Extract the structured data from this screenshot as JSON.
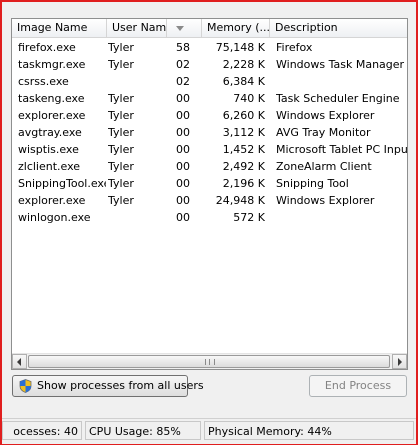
{
  "columns": {
    "image_name": "Image Name",
    "user_name": "User Name",
    "cpu": "",
    "memory": "Memory (...",
    "description": "Description"
  },
  "processes": [
    {
      "name": "firefox.exe",
      "user": "Tyler",
      "cpu": "58",
      "memory": "75,148 K",
      "description": "Firefox"
    },
    {
      "name": "taskmgr.exe",
      "user": "Tyler",
      "cpu": "02",
      "memory": "2,228 K",
      "description": "Windows Task Manager"
    },
    {
      "name": "csrss.exe",
      "user": "",
      "cpu": "02",
      "memory": "6,384 K",
      "description": ""
    },
    {
      "name": "taskeng.exe",
      "user": "Tyler",
      "cpu": "00",
      "memory": "740 K",
      "description": "Task Scheduler Engine"
    },
    {
      "name": "explorer.exe",
      "user": "Tyler",
      "cpu": "00",
      "memory": "6,260 K",
      "description": "Windows Explorer"
    },
    {
      "name": "avgtray.exe",
      "user": "Tyler",
      "cpu": "00",
      "memory": "3,112 K",
      "description": "AVG Tray Monitor"
    },
    {
      "name": "wisptis.exe",
      "user": "Tyler",
      "cpu": "00",
      "memory": "1,452 K",
      "description": "Microsoft Tablet PC Input C"
    },
    {
      "name": "zlclient.exe",
      "user": "Tyler",
      "cpu": "00",
      "memory": "2,492 K",
      "description": "ZoneAlarm Client"
    },
    {
      "name": "SnippingTool.exe",
      "user": "Tyler",
      "cpu": "00",
      "memory": "2,196 K",
      "description": "Snipping Tool"
    },
    {
      "name": "explorer.exe",
      "user": "Tyler",
      "cpu": "00",
      "memory": "24,948 K",
      "description": "Windows Explorer"
    },
    {
      "name": "winlogon.exe",
      "user": "",
      "cpu": "00",
      "memory": "572 K",
      "description": ""
    }
  ],
  "buttons": {
    "show_all_processes": "Show processes from all users",
    "end_process": "End Process"
  },
  "status": {
    "processes": "ocesses: 40",
    "cpu_usage": "CPU Usage: 85%",
    "physical_memory": "Physical Memory: 44%"
  },
  "icons": {
    "shield": "uac-shield-icon",
    "sort": "sort-descending-icon",
    "scroll_left": "scroll-left-arrow-icon",
    "scroll_right": "scroll-right-arrow-icon"
  },
  "colors": {
    "frame_border": "#e01e1e",
    "window_bg": "#f0f0f0",
    "list_bg": "#ffffff",
    "disabled_text": "#838383"
  }
}
